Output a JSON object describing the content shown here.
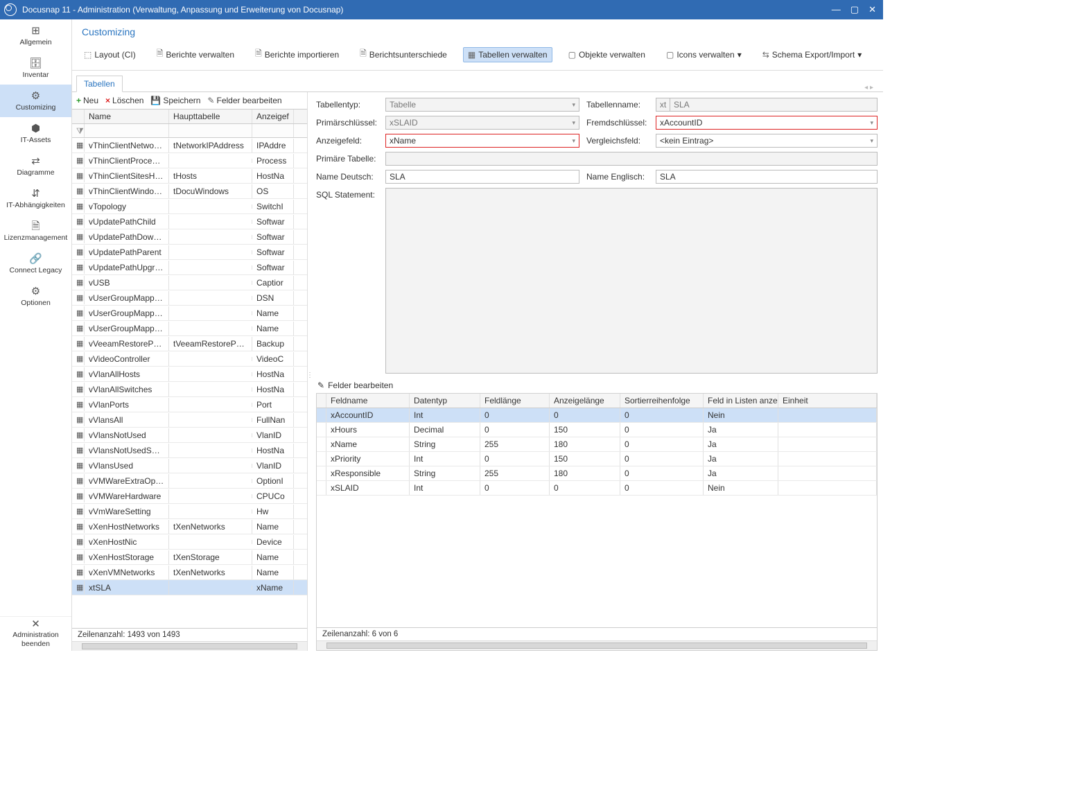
{
  "window": {
    "title": "Docusnap 11 - Administration (Verwaltung, Anpassung und Erweiterung von Docusnap)"
  },
  "sidebar": {
    "items": [
      "Allgemein",
      "Inventar",
      "Customizing",
      "IT-Assets",
      "Diagramme",
      "IT-Abhängigkeiten",
      "Lizenzmanagement",
      "Connect Legacy",
      "Optionen"
    ],
    "active_index": 2,
    "close": "Administration beenden"
  },
  "heading": "Customizing",
  "toolbar": {
    "items": [
      "Layout (CI)",
      "Berichte verwalten",
      "Berichte importieren",
      "Berichtsunterschiede",
      "Tabellen verwalten",
      "Objekte verwalten",
      "Icons verwalten",
      "Schema Export/Import"
    ],
    "active_index": 4
  },
  "tab": "Tabellen",
  "table_actions": {
    "new": "Neu",
    "del": "Löschen",
    "save": "Speichern",
    "edit": "Felder bearbeiten"
  },
  "table_cols": {
    "name": "Name",
    "main": "Haupttabelle",
    "disp": "Anzeigef"
  },
  "tables": [
    {
      "name": "vThinClientNetworkIP",
      "main": "tNetworkIPAddress",
      "disp": "IPAddre"
    },
    {
      "name": "vThinClientProcessor",
      "main": "",
      "disp": "Process"
    },
    {
      "name": "vThinClientSitesHosts",
      "main": "tHosts",
      "disp": "HostNa"
    },
    {
      "name": "vThinClientWindowsDo...",
      "main": "tDocuWindows",
      "disp": "OS"
    },
    {
      "name": "vTopology",
      "main": "",
      "disp": "SwitchI"
    },
    {
      "name": "vUpdatePathChild",
      "main": "",
      "disp": "Softwar"
    },
    {
      "name": "vUpdatePathDowngrade",
      "main": "",
      "disp": "Softwar"
    },
    {
      "name": "vUpdatePathParent",
      "main": "",
      "disp": "Softwar"
    },
    {
      "name": "vUpdatePathUpgrade",
      "main": "",
      "disp": "Softwar"
    },
    {
      "name": "vUSB",
      "main": "",
      "disp": "Captior"
    },
    {
      "name": "vUserGroupMappingD...",
      "main": "",
      "disp": "DSN"
    },
    {
      "name": "vUserGroupMappings",
      "main": "",
      "disp": "Name"
    },
    {
      "name": "vUserGroupMappingsF...",
      "main": "",
      "disp": "Name"
    },
    {
      "name": "vVeeamRestorePoint",
      "main": "tVeeamRestorePoint",
      "disp": "Backup"
    },
    {
      "name": "vVideoController",
      "main": "",
      "disp": "VideoC"
    },
    {
      "name": "vVlanAllHosts",
      "main": "",
      "disp": "HostNa"
    },
    {
      "name": "vVlanAllSwitches",
      "main": "",
      "disp": "HostNa"
    },
    {
      "name": "vVlanPorts",
      "main": "",
      "disp": "Port"
    },
    {
      "name": "vVlansAll",
      "main": "",
      "disp": "FullNan"
    },
    {
      "name": "vVlansNotUsed",
      "main": "",
      "disp": "VlanID"
    },
    {
      "name": "vVlansNotUsedSwitches",
      "main": "",
      "disp": "HostNa"
    },
    {
      "name": "vVlansUsed",
      "main": "",
      "disp": "VlanID"
    },
    {
      "name": "vVMWareExtraOptions",
      "main": "",
      "disp": "OptionI"
    },
    {
      "name": "vVMWareHardware",
      "main": "",
      "disp": "CPUCo"
    },
    {
      "name": "vVmWareSetting",
      "main": "",
      "disp": "Hw"
    },
    {
      "name": "vXenHostNetworks",
      "main": "tXenNetworks",
      "disp": "Name"
    },
    {
      "name": "vXenHostNic",
      "main": "",
      "disp": "Device"
    },
    {
      "name": "vXenHostStorage",
      "main": "tXenStorage",
      "disp": "Name"
    },
    {
      "name": "vXenVMNetworks",
      "main": "tXenNetworks",
      "disp": "Name"
    },
    {
      "name": "xtSLA",
      "main": "",
      "disp": "xName"
    }
  ],
  "selected_table_index": 29,
  "table_footer": "Zeilenanzahl: 1493 von 1493",
  "form": {
    "l_type": "Tabellentyp:",
    "type": "Tabelle",
    "l_tname": "Tabellenname:",
    "tprefix": "xt",
    "tname": "SLA",
    "l_pk": "Primärschlüssel:",
    "pk": "xSLAID",
    "l_fk": "Fremdschlüssel:",
    "fk": "xAccountID",
    "l_disp": "Anzeigefeld:",
    "disp": "xName",
    "l_cmp": "Vergleichsfeld:",
    "cmp": "<kein Eintrag>",
    "l_prim": "Primäre Tabelle:",
    "l_de": "Name Deutsch:",
    "de": "SLA",
    "l_en": "Name Englisch:",
    "en": "SLA",
    "l_sql": "SQL Statement:"
  },
  "edit_fields_label": "Felder bearbeiten",
  "field_cols": {
    "name": "Feldname",
    "type": "Datentyp",
    "len": "Feldlänge",
    "disp": "Anzeigelänge",
    "sort": "Sortierreihenfolge",
    "show": "Feld in Listen anzeigen",
    "unit": "Einheit"
  },
  "fields": [
    {
      "name": "xAccountID",
      "type": "Int",
      "len": "0",
      "disp": "0",
      "sort": "0",
      "show": "Nein"
    },
    {
      "name": "xHours",
      "type": "Decimal",
      "len": "0",
      "disp": "150",
      "sort": "0",
      "show": "Ja"
    },
    {
      "name": "xName",
      "type": "String",
      "len": "255",
      "disp": "180",
      "sort": "0",
      "show": "Ja"
    },
    {
      "name": "xPriority",
      "type": "Int",
      "len": "0",
      "disp": "150",
      "sort": "0",
      "show": "Ja"
    },
    {
      "name": "xResponsible",
      "type": "String",
      "len": "255",
      "disp": "180",
      "sort": "0",
      "show": "Ja"
    },
    {
      "name": "xSLAID",
      "type": "Int",
      "len": "0",
      "disp": "0",
      "sort": "0",
      "show": "Nein"
    }
  ],
  "fields_footer": "Zeilenanzahl: 6 von 6"
}
